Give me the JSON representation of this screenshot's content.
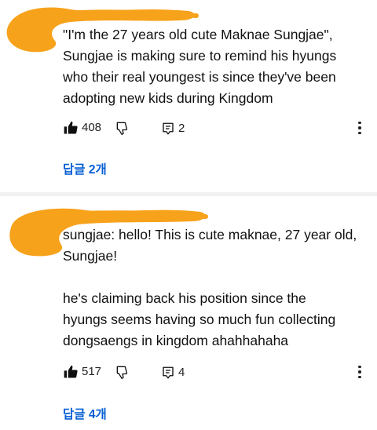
{
  "colors": {
    "accent": "#065fd4",
    "scribble": "#f7a21b",
    "divider": "#f1f1f1"
  },
  "comments": [
    {
      "text": "\"I'm the 27 years old cute Maknae Sungjae\",\nSungjae is making sure to remind his hyungs\nwho their real youngest is since they've been\nadopting new kids during Kingdom",
      "likes": "408",
      "replies_count": "2",
      "reply_link": "답글 2개"
    },
    {
      "text": "sungjae: hello! This is cute maknae, 27 year old,\nSungjae!\n\nhe's claiming back his position since the\nhyungs seems having so much fun collecting\ndongsaengs in kingdom ahahhahaha",
      "likes": "517",
      "replies_count": "4",
      "reply_link": "답글 4개"
    }
  ],
  "icons": [
    "thumbs-up-icon",
    "thumbs-down-icon",
    "comment-reply-icon",
    "more-vert-icon"
  ]
}
